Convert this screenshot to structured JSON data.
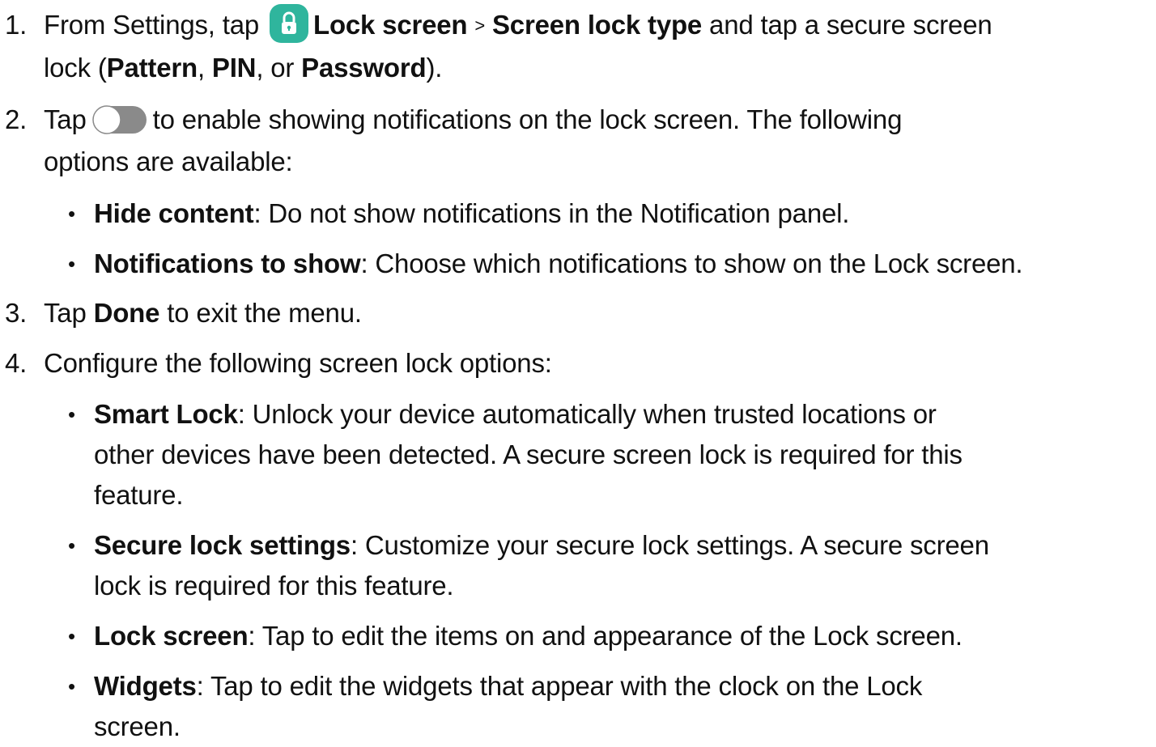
{
  "steps": [
    {
      "num": "1.",
      "t1": "From Settings, tap",
      "b1": "Lock screen",
      "sep": ">",
      "b2": "Screen lock type",
      "t2": "and tap a secure screen",
      "t3": "lock (",
      "b3": "Pattern",
      "t4": ",",
      "b4": "PIN",
      "t5": ", or",
      "b5": "Password",
      "t6": ")."
    },
    {
      "num": "2.",
      "t1": "Tap",
      "t2": "to enable showing notifications on the lock screen. The following",
      "t3": "options are available:"
    },
    {
      "num": "3.",
      "t1": "Tap",
      "b1": "Done",
      "t2": "to exit the menu."
    },
    {
      "num": "4.",
      "t1": "Configure the following screen lock options:"
    }
  ],
  "bullets": [
    {
      "term": "Hide content",
      "text": ": Do not show notifications in the Notification panel."
    },
    {
      "term": "Notifications to show",
      "text": ": Choose which notifications to show on the Lock screen."
    },
    {
      "term": "Smart Lock",
      "text": ": Unlock your device automatically when trusted locations or",
      "line2": "other devices have been detected. A secure screen lock is required for this",
      "line3": "feature."
    },
    {
      "term": "Secure lock settings",
      "text": ": Customize your secure lock settings. A secure screen",
      "line2": "lock is required for this feature."
    },
    {
      "term": "Lock screen",
      "text": ": Tap to edit the items on and appearance of the Lock screen."
    },
    {
      "term": "Widgets",
      "text": ": Tap to edit the widgets that appear with the clock on the Lock",
      "line2": "screen."
    }
  ],
  "bullet_glyph": "•",
  "icons": {
    "lock": "lock-icon",
    "toggle": "toggle-icon"
  },
  "colors": {
    "lock_icon_bg": "#2fb59d",
    "toggle_track": "#8a8a8a"
  }
}
